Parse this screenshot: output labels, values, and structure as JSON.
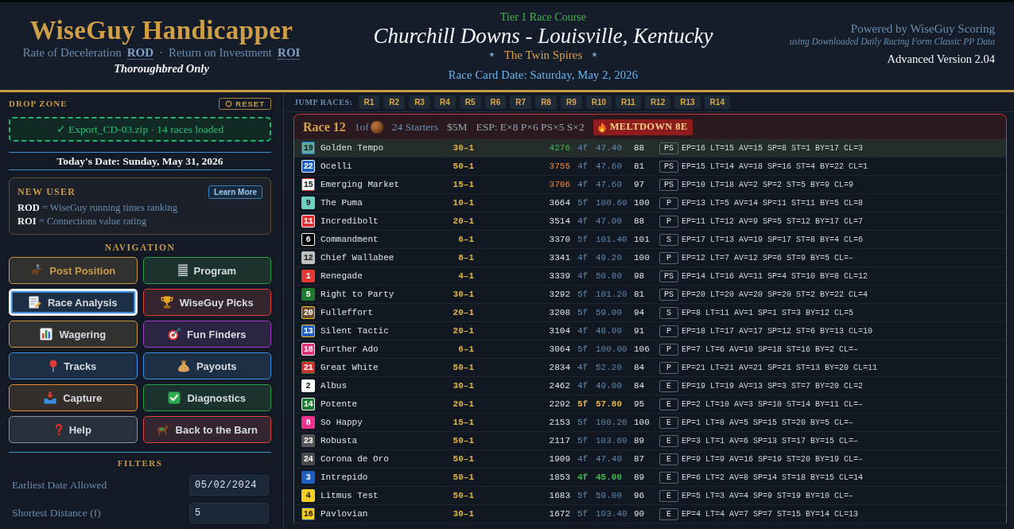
{
  "header": {
    "brand": {
      "title": "WiseGuy Handicapper",
      "terms": [
        {
          "label": "Rate of Deceleration",
          "abbreviation": "ROD"
        },
        {
          "label": "Return on Investment",
          "abbreviation": "ROI"
        }
      ],
      "separator": "·",
      "tagline": "Thoroughbred Only"
    },
    "course": {
      "tier": "Tier 1 Race Course",
      "track": "Churchill Downs - Louisville, Kentucky",
      "nickname": "The Twin Spires",
      "race_card_date": "Race Card Date: Saturday, May 2, 2026"
    },
    "credits": {
      "powered_by": "Powered by WiseGuy Scoring",
      "data_source": "using Downloaded Daily Racing Form Classic PP Data",
      "version": "Advanced Version 2.04"
    }
  },
  "sidebar": {
    "drop_zone": {
      "heading": "DROP ZONE",
      "reset_button": "RESET",
      "status": "✓ Export_CD-03.zip · 14 races loaded"
    },
    "todays_date": "Today's Date: Sunday, May 31, 2026",
    "new_user": {
      "heading": "NEW USER",
      "button": "Learn More",
      "definitions": [
        "**ROD** = WiseGuy running times ranking",
        "**ROI** = Connections value rating"
      ]
    },
    "navigation": {
      "heading": "NAVIGATION",
      "items": [
        {
          "label": "Post Position",
          "color": "#c99a45",
          "selected": false,
          "accent_label": true
        },
        {
          "label": "Program",
          "color": "#2ea043",
          "selected": false,
          "accent_label": false
        },
        {
          "label": "Race Analysis",
          "color": "#3d8ee0",
          "selected": true,
          "accent_label": false
        },
        {
          "label": "WiseGuy Picks",
          "color": "#e03c3c",
          "selected": false,
          "accent_label": false
        },
        {
          "label": "Wagering",
          "color": "#c99a45",
          "selected": false,
          "accent_label": false
        },
        {
          "label": "Fun Finders",
          "color": "#a03cc8",
          "selected": false,
          "accent_label": false
        },
        {
          "label": "Tracks",
          "color": "#3d8ee0",
          "selected": false,
          "accent_label": false
        },
        {
          "label": "Payouts",
          "color": "#3d8ee0",
          "selected": false,
          "accent_label": false
        },
        {
          "label": "Capture",
          "color": "#e8892e",
          "selected": false,
          "accent_label": false
        },
        {
          "label": "Diagnostics",
          "color": "#2ea043",
          "selected": false,
          "accent_label": false
        },
        {
          "label": "Help",
          "color": "#8a8f98",
          "selected": false,
          "accent_label": false
        },
        {
          "label": "Back to the Barn",
          "color": "#e04545",
          "selected": false,
          "accent_label": false
        }
      ]
    },
    "filters": {
      "heading": "FILTERS",
      "fields": [
        {
          "label": "Earliest Date Allowed",
          "value": "05/02/2024"
        },
        {
          "label": "Shortest Distance (f)",
          "value": "5"
        }
      ]
    }
  },
  "jump_races": {
    "label": "JUMP RACES:",
    "races": [
      "R1",
      "R2",
      "R3",
      "R4",
      "R5",
      "R6",
      "R7",
      "R8",
      "R9",
      "R10",
      "R11",
      "R12",
      "R13",
      "R14"
    ]
  },
  "race": {
    "title": "Race 12",
    "position": "1of",
    "starters": "24 Starters",
    "purse": "$5M",
    "esp": "ESP: E×8 P×6 PS×5 S×2",
    "alert": "MELTDOWN 8E",
    "rows": [
      {
        "post": "19",
        "color": "#5fa8a0",
        "edge": {
          "color": "#1f6fd0"
        },
        "name": "Golden Tempo",
        "odds": "30–1",
        "score": {
          "value": "4276",
          "color": "#3fb950"
        },
        "time": {
          "distance": "4f",
          "value": "47.40",
          "highlighted": false,
          "color": "#5f88ad"
        },
        "speed": "88",
        "style": "PS",
        "stats": "EP=16 LT=15 AV=15 SP=8 ST=1 BY=17 CL=3",
        "selected": true
      },
      {
        "post": "22",
        "color": "#1e5fc0",
        "edge": {
          "color": "#ffffff"
        },
        "name": "Ocelli",
        "odds": "50–1",
        "score": {
          "value": "3755",
          "color": "#f0883e"
        },
        "time": {
          "distance": "4f",
          "value": "47.60",
          "highlighted": false,
          "color": "#5f88ad"
        },
        "speed": "81",
        "style": "PS",
        "stats": "EP=15 LT=14 AV=18 SP=16 ST=4 BY=22 CL=1",
        "selected": false
      },
      {
        "post": "15",
        "color": "#ffffff",
        "edge": {
          "color": "#e03030"
        },
        "name": "Emerging Market",
        "odds": "15–1",
        "score": {
          "value": "3706",
          "color": "#f0883e"
        },
        "time": {
          "distance": "4f",
          "value": "47.60",
          "highlighted": false,
          "color": "#5f88ad"
        },
        "speed": "97",
        "style": "PS",
        "stats": "EP=10 LT=18 AV=2 SP=2 ST=5 BY=9 CL=9",
        "selected": false
      },
      {
        "post": "9",
        "color": "#6fd0c0",
        "edge": {
          "color": "#6fd0c0"
        },
        "name": "The Puma",
        "odds": "10–1",
        "score": {
          "value": "3664"
        },
        "time": {
          "distance": "5f",
          "value": "100.60",
          "highlighted": false,
          "color": "#5f88ad"
        },
        "speed": "100",
        "style": "P",
        "stats": "EP=13 LT=5 AV=14 SP=11 ST=11 BY=5 CL=8",
        "selected": false
      },
      {
        "post": "11",
        "color": "#e03030",
        "edge": {
          "color": "#ffffff"
        },
        "name": "Incredibolt",
        "odds": "20–1",
        "score": {
          "value": "3514"
        },
        "time": {
          "distance": "4f",
          "value": "47.00",
          "highlighted": false,
          "color": "#5f88ad"
        },
        "speed": "88",
        "style": "P",
        "stats": "EP=11 LT=12 AV=9 SP=5 ST=12 BY=17 CL=7",
        "selected": false
      },
      {
        "post": "6",
        "color": "#000000",
        "edge": {
          "color": "#ffffff"
        },
        "name": "Commandment",
        "odds": "6–1",
        "score": {
          "value": "3370"
        },
        "time": {
          "distance": "5f",
          "value": "101.40",
          "highlighted": false,
          "color": "#5f88ad"
        },
        "speed": "101",
        "style": "S",
        "stats": "EP=17 LT=13 AV=19 SP=17 ST=8 BY=4 CL=6",
        "selected": false
      },
      {
        "post": "12",
        "color": "#c0c0c0",
        "edge": {
          "color": "#c0c0c0"
        },
        "name": "Chief Wallabee",
        "odds": "8–1",
        "score": {
          "value": "3341"
        },
        "time": {
          "distance": "4f",
          "value": "49.20",
          "highlighted": false,
          "color": "#5f88ad"
        },
        "speed": "100",
        "style": "P",
        "stats": "EP=12 LT=7 AV=12 SP=6 ST=9 BY=5 CL=–",
        "selected": false
      },
      {
        "post": "1",
        "color": "#e53935",
        "edge": {
          "color": "#e53935"
        },
        "name": "Renegade",
        "odds": "4–1",
        "score": {
          "value": "3339"
        },
        "time": {
          "distance": "4f",
          "value": "50.80",
          "highlighted": false,
          "color": "#5f88ad"
        },
        "speed": "98",
        "style": "PS",
        "stats": "EP=14 LT=16 AV=11 SP=4 ST=10 BY=8 CL=12",
        "selected": false
      },
      {
        "post": "5",
        "color": "#1e7a2e",
        "edge": {
          "color": "#1e7a2e"
        },
        "name": "Right to Party",
        "odds": "30–1",
        "score": {
          "value": "3292"
        },
        "time": {
          "distance": "5f",
          "value": "101.20",
          "highlighted": false,
          "color": "#5f88ad"
        },
        "speed": "81",
        "style": "PS",
        "stats": "EP=20 LT=20 AV=20 SP=20 ST=2 BY=22 CL=4",
        "selected": false
      },
      {
        "post": "20",
        "color": "#6b4a2e",
        "edge": {
          "color": "#f0c020"
        },
        "name": "Fulleffort",
        "odds": "20–1",
        "score": {
          "value": "3208"
        },
        "time": {
          "distance": "5f",
          "value": "59.00",
          "highlighted": false,
          "color": "#5f88ad"
        },
        "speed": "94",
        "style": "S",
        "stats": "EP=8 LT=11 AV=1 SP=1 ST=3 BY=12 CL=5",
        "selected": false
      },
      {
        "post": "13",
        "color": "#1e5fc0",
        "edge": {
          "color": "#f0c020"
        },
        "name": "Silent Tactic",
        "odds": "20–1",
        "score": {
          "value": "3104"
        },
        "time": {
          "distance": "4f",
          "value": "48.00",
          "highlighted": false,
          "color": "#5f88ad"
        },
        "speed": "91",
        "style": "P",
        "stats": "EP=18 LT=17 AV=17 SP=12 ST=6 BY=13 CL=10",
        "selected": false
      },
      {
        "post": "18",
        "color": "#e0307a",
        "edge": {
          "color": "#ffffff"
        },
        "name": "Further Ado",
        "odds": "6–1",
        "score": {
          "value": "3064"
        },
        "time": {
          "distance": "5f",
          "value": "100.00",
          "highlighted": false,
          "color": "#5f88ad"
        },
        "speed": "106",
        "style": "P",
        "stats": "EP=7 LT=6 AV=10 SP=18 ST=16 BY=2 CL=–",
        "selected": false
      },
      {
        "post": "21",
        "color": "#d03030",
        "edge": {
          "color": "#1e7a2e"
        },
        "name": "Great White",
        "odds": "50–1",
        "score": {
          "value": "2834"
        },
        "time": {
          "distance": "4f",
          "value": "52.20",
          "highlighted": false,
          "color": "#5f88ad"
        },
        "speed": "84",
        "style": "P",
        "stats": "EP=21 LT=21 AV=21 SP=21 ST=13 BY=20 CL=11",
        "selected": false
      },
      {
        "post": "2",
        "color": "#ffffff",
        "edge": {
          "color": "#ffffff"
        },
        "name": "Albus",
        "odds": "30–1",
        "score": {
          "value": "2462"
        },
        "time": {
          "distance": "4f",
          "value": "49.00",
          "highlighted": false,
          "color": "#5f88ad"
        },
        "speed": "84",
        "style": "E",
        "stats": "EP=19 LT=19 AV=13 SP=3 ST=7 BY=20 CL=2",
        "selected": false
      },
      {
        "post": "14",
        "color": "#1e7a2e",
        "edge": {
          "color": "#ffffff"
        },
        "name": "Potente",
        "odds": "20–1",
        "score": {
          "value": "2292"
        },
        "time": {
          "distance": "5f",
          "value": "57.80",
          "highlighted": true,
          "color": "#e3b341"
        },
        "speed": "95",
        "style": "E",
        "stats": "EP=2 LT=10 AV=3 SP=10 ST=14 BY=11 CL=–",
        "selected": false
      },
      {
        "post": "8",
        "color": "#f0308a",
        "edge": {
          "color": "#f0308a"
        },
        "name": "So Happy",
        "odds": "15–1",
        "score": {
          "value": "2153"
        },
        "time": {
          "distance": "5f",
          "value": "100.20",
          "highlighted": false,
          "color": "#5f88ad"
        },
        "speed": "100",
        "style": "E",
        "stats": "EP=1 LT=8 AV=5 SP=15 ST=20 BY=5 CL=–",
        "selected": false
      },
      {
        "post": "23",
        "color": "#555555",
        "edge": {
          "color": "#555555"
        },
        "name": "Robusta",
        "odds": "50–1",
        "score": {
          "value": "2117"
        },
        "time": {
          "distance": "5f",
          "value": "103.60",
          "highlighted": false,
          "color": "#5f88ad"
        },
        "speed": "89",
        "style": "E",
        "stats": "EP=3 LT=1 AV=6 SP=13 ST=17 BY=15 CL=–",
        "selected": false
      },
      {
        "post": "24",
        "color": "#4a4a4a",
        "edge": {
          "color": "#4a4a4a"
        },
        "name": "Corona de Oro",
        "odds": "50–1",
        "score": {
          "value": "1909"
        },
        "time": {
          "distance": "4f",
          "value": "47.40",
          "highlighted": false,
          "color": "#5f88ad"
        },
        "speed": "87",
        "style": "E",
        "stats": "EP=9 LT=9 AV=16 SP=19 ST=20 BY=19 CL=–",
        "selected": false
      },
      {
        "post": "3",
        "color": "#1e5fc0",
        "edge": {
          "color": "#1e5fc0"
        },
        "name": "Intrepido",
        "odds": "50–1",
        "score": {
          "value": "1853"
        },
        "time": {
          "distance": "4f",
          "value": "45.00",
          "highlighted": true,
          "color": "#3fb950"
        },
        "speed": "89",
        "style": "E",
        "stats": "EP=6 LT=2 AV=8 SP=14 ST=18 BY=15 CL=14",
        "selected": false
      },
      {
        "post": "4",
        "color": "#f5d020",
        "edge": {
          "color": "#f5d020"
        },
        "name": "Litmus Test",
        "odds": "50–1",
        "score": {
          "value": "1683"
        },
        "time": {
          "distance": "5f",
          "value": "59.00",
          "highlighted": false,
          "color": "#5f88ad"
        },
        "speed": "96",
        "style": "E",
        "stats": "EP=5 LT=3 AV=4 SP=9 ST=19 BY=10 CL=–",
        "selected": false
      },
      {
        "post": "16",
        "color": "#f5d020",
        "edge": {
          "color": "#1e5fc0"
        },
        "name": "Pavlovian",
        "odds": "30–1",
        "score": {
          "value": "1672"
        },
        "time": {
          "distance": "5f",
          "value": "103.40",
          "highlighted": false,
          "color": "#5f88ad"
        },
        "speed": "90",
        "style": "E",
        "stats": "EP=4 LT=4 AV=7 SP=7 ST=15 BY=14 CL=13",
        "selected": false
      }
    ]
  }
}
